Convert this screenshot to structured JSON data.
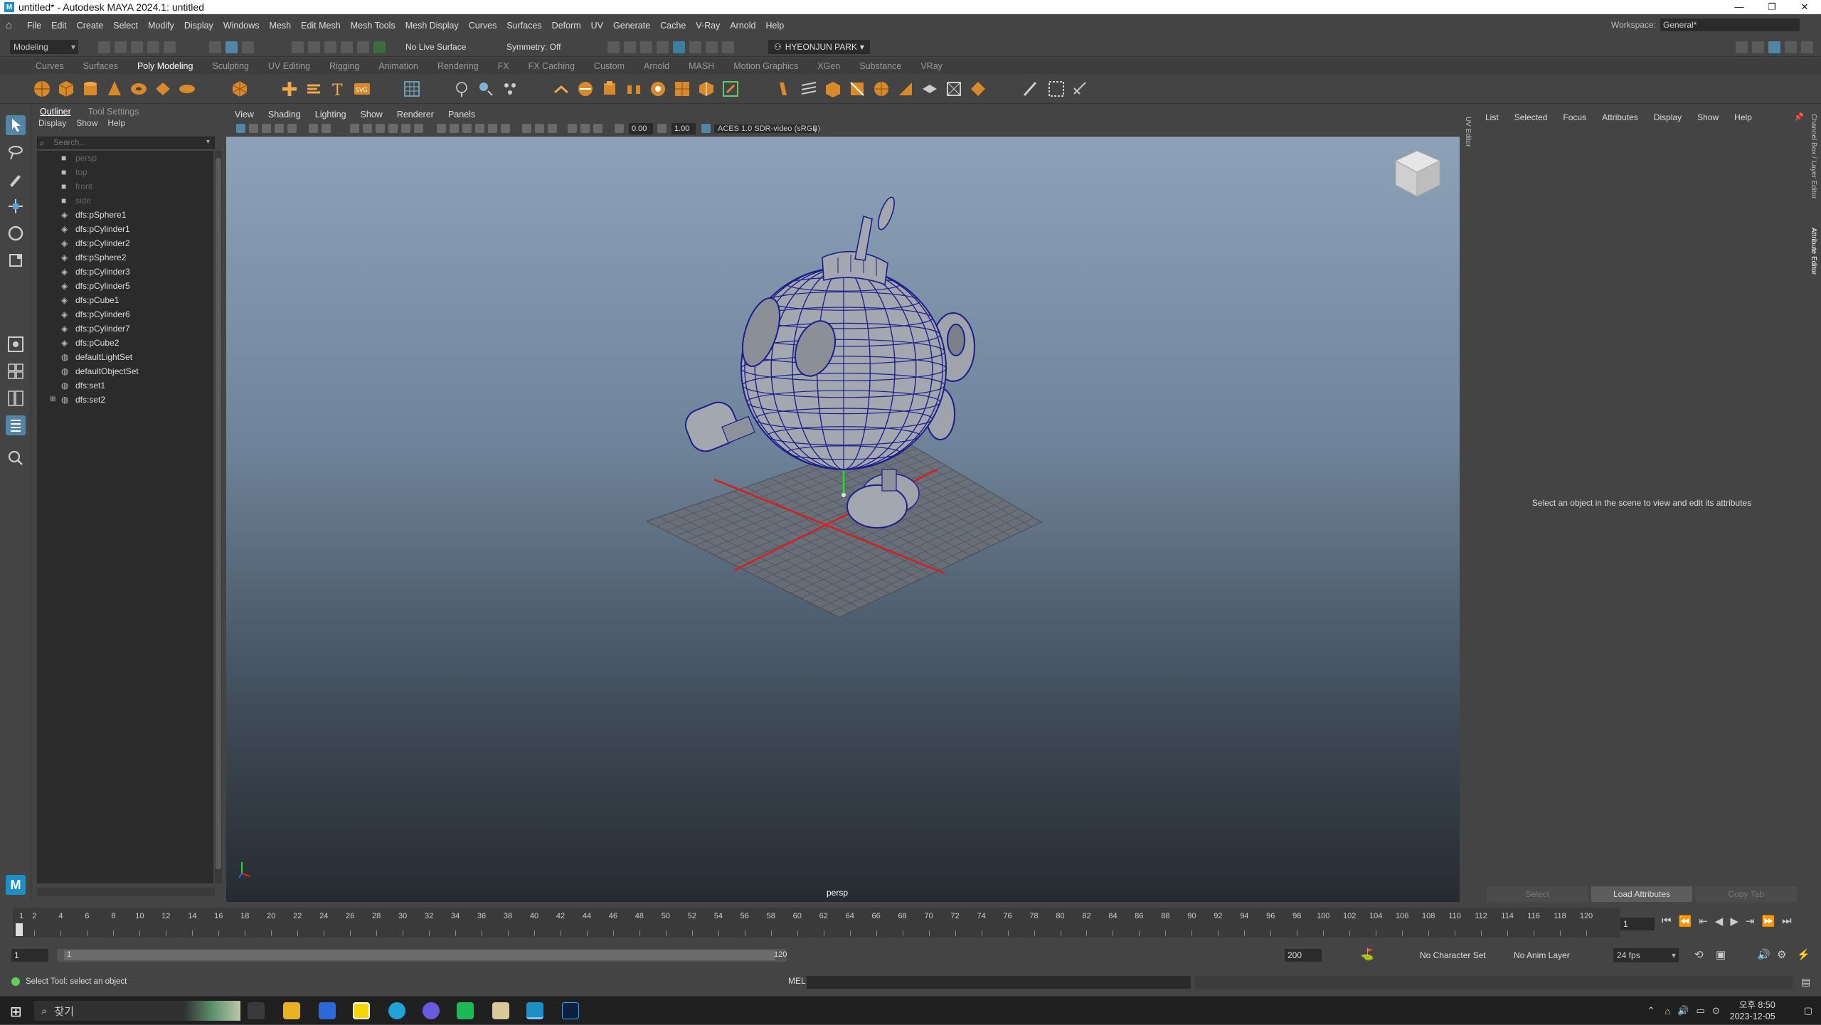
{
  "window": {
    "title": "untitled* - Autodesk MAYA 2024.1: untitled",
    "logo": "M",
    "controls": [
      "—",
      "❐",
      "✕"
    ]
  },
  "menubar": {
    "items": [
      "File",
      "Edit",
      "Create",
      "Select",
      "Modify",
      "Display",
      "Windows",
      "Mesh",
      "Edit Mesh",
      "Mesh Tools",
      "Mesh Display",
      "Curves",
      "Surfaces",
      "Deform",
      "UV",
      "Generate",
      "Cache",
      "V-Ray",
      "Arnold",
      "Help"
    ]
  },
  "workspace": {
    "label": "Workspace:",
    "value": "General*"
  },
  "statusline": {
    "mode": "Modeling",
    "live_surface": "No Live Surface",
    "symmetry": "Symmetry: Off",
    "user": "HYEONJUN PARK"
  },
  "shelf_tabs": {
    "items": [
      "Curves",
      "Surfaces",
      "Poly Modeling",
      "Sculpting",
      "UV Editing",
      "Rigging",
      "Animation",
      "Rendering",
      "FX",
      "FX Caching",
      "Custom",
      "Arnold",
      "MASH",
      "Motion Graphics",
      "XGen",
      "Substance",
      "VRay"
    ],
    "active": "Poly Modeling"
  },
  "outliner": {
    "tabs": [
      "Outliner",
      "Tool Settings"
    ],
    "menus": [
      "Display",
      "Show",
      "Help"
    ],
    "search_placeholder": "Search...",
    "items": [
      {
        "label": "persp",
        "kind": "camera",
        "dim": true
      },
      {
        "label": "top",
        "kind": "camera",
        "dim": true
      },
      {
        "label": "front",
        "kind": "camera",
        "dim": true
      },
      {
        "label": "side",
        "kind": "camera",
        "dim": true
      },
      {
        "label": "dfs:pSphere1",
        "kind": "mesh"
      },
      {
        "label": "dfs:pCylinder1",
        "kind": "mesh"
      },
      {
        "label": "dfs:pCylinder2",
        "kind": "mesh"
      },
      {
        "label": "dfs:pSphere2",
        "kind": "mesh"
      },
      {
        "label": "dfs:pCylinder3",
        "kind": "mesh"
      },
      {
        "label": "dfs:pCylinder5",
        "kind": "mesh"
      },
      {
        "label": "dfs:pCube1",
        "kind": "mesh"
      },
      {
        "label": "dfs:pCylinder6",
        "kind": "mesh"
      },
      {
        "label": "dfs:pCylinder7",
        "kind": "mesh"
      },
      {
        "label": "dfs:pCube2",
        "kind": "mesh"
      },
      {
        "label": "defaultLightSet",
        "kind": "set"
      },
      {
        "label": "defaultObjectSet",
        "kind": "set"
      },
      {
        "label": "dfs:set1",
        "kind": "set"
      },
      {
        "label": "dfs:set2",
        "kind": "set",
        "expandable": true
      }
    ]
  },
  "viewport": {
    "menus": [
      "View",
      "Shading",
      "Lighting",
      "Show",
      "Renderer",
      "Panels"
    ],
    "exposure": "0.00",
    "gamma": "1.00",
    "color_space": "ACES 1.0 SDR-video (sRGB)",
    "camera_label": "persp"
  },
  "uv_editor_tab": "UV Editor",
  "attribute_editor": {
    "menus": [
      "List",
      "Selected",
      "Focus",
      "Attributes",
      "Display",
      "Show",
      "Help"
    ],
    "message": "Select an object in the scene to view and edit its attributes",
    "buttons": [
      "Select",
      "Load Attributes",
      "Copy Tab"
    ],
    "side_tabs": [
      "Channel Box / Layer Editor",
      "Attribute Editor"
    ]
  },
  "time_slider": {
    "ticks": [
      "1",
      "2",
      "4",
      "6",
      "8",
      "10",
      "12",
      "14",
      "16",
      "18",
      "20",
      "22",
      "24",
      "26",
      "28",
      "30",
      "32",
      "34",
      "36",
      "38",
      "40",
      "42",
      "44",
      "46",
      "48",
      "50",
      "52",
      "54",
      "56",
      "58",
      "60",
      "62",
      "64",
      "66",
      "68",
      "70",
      "72",
      "74",
      "76",
      "78",
      "80",
      "82",
      "84",
      "86",
      "88",
      "90",
      "92",
      "94",
      "96",
      "98",
      "100",
      "102",
      "104",
      "106",
      "108",
      "110",
      "112",
      "114",
      "116",
      "118",
      "120"
    ],
    "current_frame": "1"
  },
  "range": {
    "start": "1",
    "inner_start": "1",
    "inner_end": "120",
    "end": "200",
    "character_set": "No Character Set",
    "anim_layer": "No Anim Layer",
    "fps": "24 fps"
  },
  "command_line": {
    "mode": "MEL",
    "help": "Select Tool: select an object"
  },
  "taskbar": {
    "search": "찾기",
    "time": "오후 8:50",
    "date": "2023-12-05"
  },
  "colors": {
    "accent": "#5285a6",
    "shelf_orange": "#d88a2a",
    "mesh_wire": "#1a1f8a",
    "grid_axis": "#d42020"
  }
}
